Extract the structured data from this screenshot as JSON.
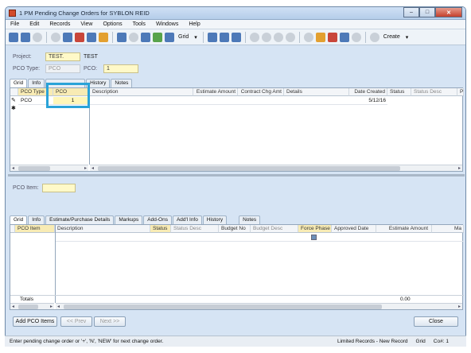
{
  "window": {
    "title": "1 PM Pending Change Orders for SYBLON REID"
  },
  "menu": [
    "File",
    "Edit",
    "Records",
    "View",
    "Options",
    "Tools",
    "Windows",
    "Help"
  ],
  "toolbar": {
    "grid_label": "Grid",
    "create_label": "Create"
  },
  "header": {
    "project_label": "Project:",
    "project_value": "TEST.",
    "project_desc": "TEST",
    "pco_type_label": "PCO Type:",
    "pco_type_value": "PCO",
    "pco_label": "PCO:",
    "pco_value": "1"
  },
  "top_tabs": [
    "Grid",
    "Info",
    "",
    "History",
    "Notes"
  ],
  "top_grid": {
    "columns": [
      "PCO Type",
      "PCO",
      "Description",
      "Estimate Amount",
      "Contract Chg Amt",
      "Details",
      "Date Created",
      "Status",
      "Status Desc",
      "P"
    ],
    "rows": [
      {
        "pco_type": "PCO",
        "pco": "1",
        "date_created": "5/12/16"
      }
    ]
  },
  "item": {
    "label": "PCO Item:",
    "value": ""
  },
  "bottom_tabs": [
    "Grid",
    "Info",
    "Estimate/Purchase Details",
    "Markups",
    "Add-Ons",
    "Add'l Info",
    "History",
    "Notes"
  ],
  "bottom_grid": {
    "columns": [
      "PCO Item",
      "Description",
      "Status",
      "Status Desc",
      "Budget No",
      "Budget Desc",
      "Force Phase",
      "Approved Date",
      "Estimate Amount",
      "Ma"
    ],
    "totals_label": "Totals",
    "totals_value": "0.00"
  },
  "buttons": {
    "add_items": "Add PCO Items",
    "prev": "<< Prev",
    "next": "Next >>",
    "close": "Close"
  },
  "status": {
    "hint": "Enter pending change order or '+', 'N', 'NEW' for next change order.",
    "mode": "Limited Records - New Record",
    "view": "Grid",
    "co": "Co#: 1"
  },
  "colors": {
    "highlight": "#2aa3d8",
    "required_field": "#fff9c8"
  }
}
